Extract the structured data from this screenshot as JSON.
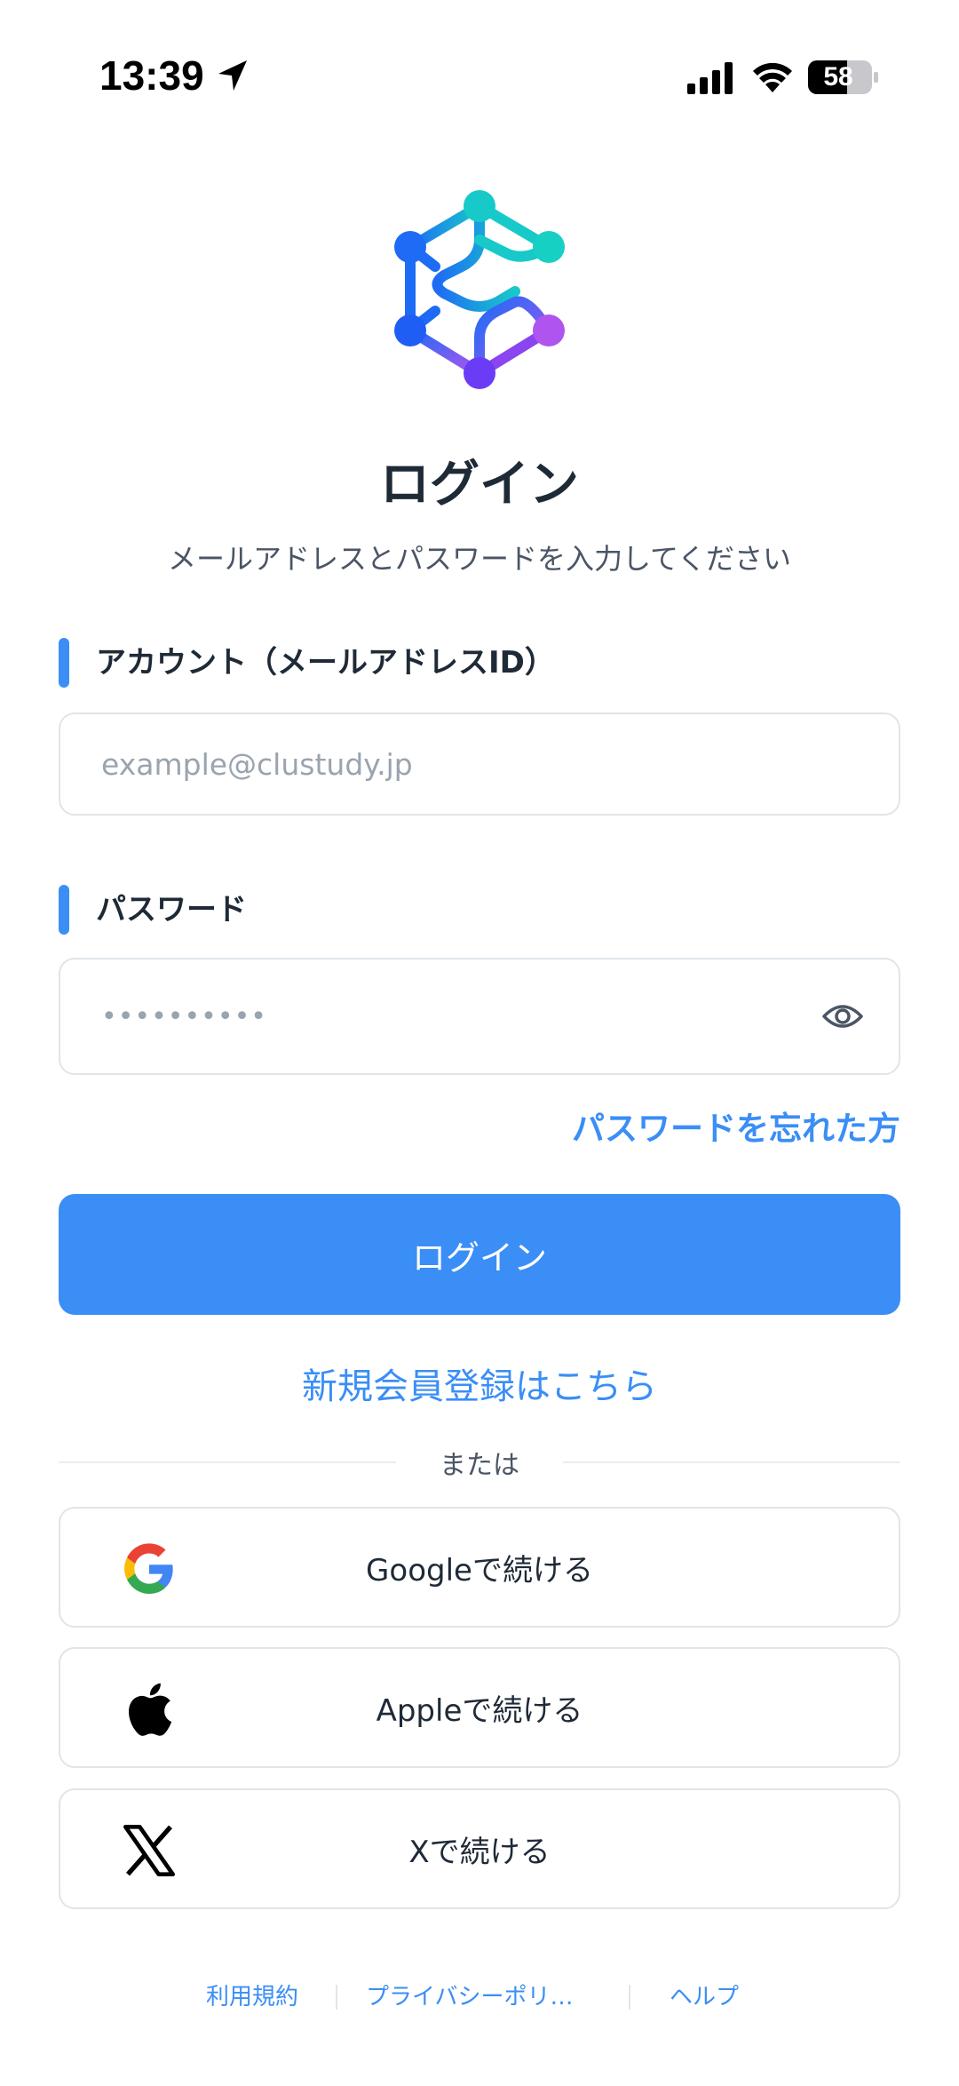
{
  "status_bar": {
    "time": "13:39",
    "battery": "58",
    "icons": [
      "location-arrow-icon",
      "signal-icon",
      "wifi-icon",
      "battery-icon"
    ]
  },
  "logo": {
    "icon": "clustudy-logo-icon",
    "colors": [
      "#1e6cf5",
      "#17c9c9",
      "#b054f0",
      "#6a3cf5"
    ]
  },
  "header": {
    "title": "ログイン",
    "subtitle": "メールアドレスとパスワードを入力してください"
  },
  "form": {
    "account_label": "アカウント（メールアドレスID）",
    "email_placeholder": "example@clustudy.jp",
    "password_label": "パスワード",
    "password_value": "••••••••••",
    "forgot_password": "パスワードを忘れた方",
    "login_button": "ログイン",
    "register_link": "新規会員登録はこちら"
  },
  "divider": {
    "text": "または"
  },
  "social": {
    "google": "Googleで続ける",
    "apple": "Appleで続ける",
    "x": "Xで続ける"
  },
  "footer": {
    "terms": "利用規約",
    "privacy": "プライバシーポリ…",
    "help": "ヘルプ"
  },
  "colors": {
    "accent": "#3a8ef6",
    "text": "#1f2a37",
    "border": "#dfe5ea"
  }
}
